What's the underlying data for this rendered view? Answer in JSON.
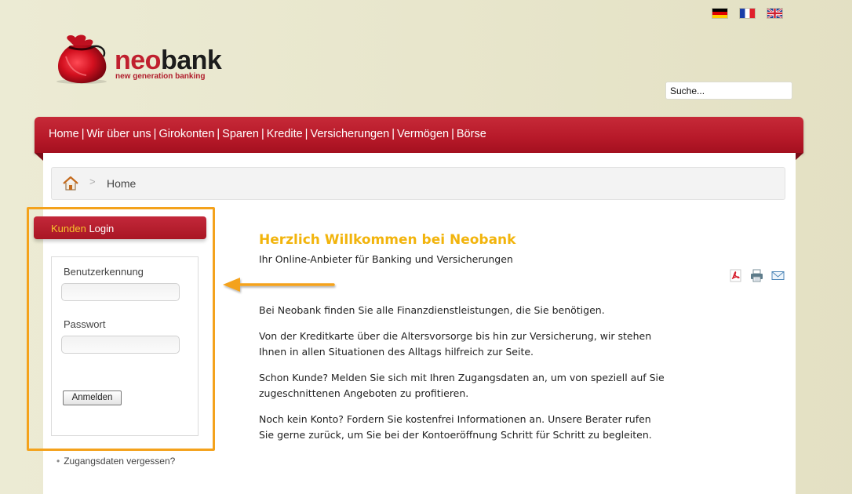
{
  "languages": [
    {
      "name": "german-flag-icon",
      "label": "Deutsch"
    },
    {
      "name": "french-flag-icon",
      "label": "Français"
    },
    {
      "name": "uk-flag-icon",
      "label": "English"
    }
  ],
  "logo": {
    "neo": "neo",
    "bank": "bank",
    "tagline": "new generation banking"
  },
  "search": {
    "value": "Suche..."
  },
  "nav": {
    "items": [
      "Home",
      "Wir über uns",
      "Girokonten",
      "Sparen",
      "Kredite",
      "Versicherungen",
      "Vermögen",
      "Börse"
    ],
    "separator": "|"
  },
  "breadcrumb": {
    "separator": ">",
    "current": "Home"
  },
  "login": {
    "title_highlight": "Kunden",
    "title_rest": " Login",
    "username_label": "Benutzerkennung",
    "password_label": "Passwort",
    "submit_label": "Anmelden",
    "forgot_label": "Zugangsdaten vergessen?"
  },
  "main": {
    "title": "Herzlich Willkommen bei Neobank",
    "subtitle": "Ihr Online-Anbieter für Banking und Versicherungen",
    "paragraphs": [
      "Bei Neobank finden Sie alle Finanzdienstleistungen, die Sie benötigen.",
      "Von der Kreditkarte über die Altersvorsorge bis hin zur Versicherung, wir stehen Ihnen in allen Situationen des Alltags hilfreich zur Seite.",
      "Schon Kunde? Melden Sie sich mit Ihren Zugangsdaten an, um von speziell auf Sie zugeschnittenen Angeboten zu profitieren.",
      "Noch kein Konto? Fordern Sie kostenfrei Informationen an. Unsere Berater rufen Sie gerne zurück, um Sie bei der Kontoeröffnung Schritt für Schritt zu begleiten."
    ],
    "tools": [
      "pdf-icon",
      "print-icon",
      "email-icon"
    ]
  },
  "colors": {
    "brand_red": "#b81a2a",
    "highlight_orange": "#f4a21c",
    "title_yellow": "#f2b40c"
  }
}
